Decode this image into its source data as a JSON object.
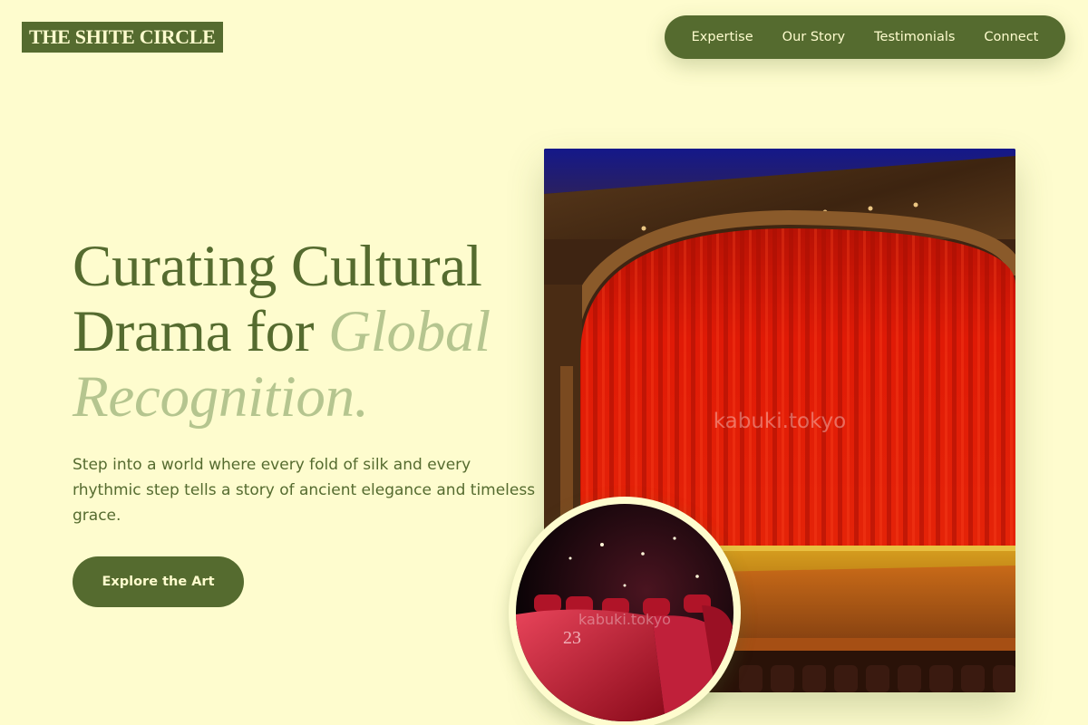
{
  "header": {
    "logo_text": "THE SHITE CIRCLE",
    "nav": [
      {
        "label": "Expertise"
      },
      {
        "label": "Our Story"
      },
      {
        "label": "Testimonials"
      },
      {
        "label": "Connect"
      }
    ]
  },
  "hero": {
    "title_line1": "Curating Cultural",
    "title_line2_plain": "Drama for ",
    "title_line2_accent": "Global",
    "title_line3_accent": "Recognition.",
    "description": "Step into a world where every fold of silk and every rhythmic step tells a story of ancient elegance and timeless grace.",
    "cta_label": "Explore the Art"
  },
  "images": {
    "stage_watermark": "kabuki.tokyo",
    "seats_watermark": "kabuki.tokyo",
    "seat_number": "23"
  },
  "colors": {
    "background": "#fefcce",
    "primary": "#556b2f",
    "accent": "#b5c58f",
    "curtain": "#d81a08"
  }
}
